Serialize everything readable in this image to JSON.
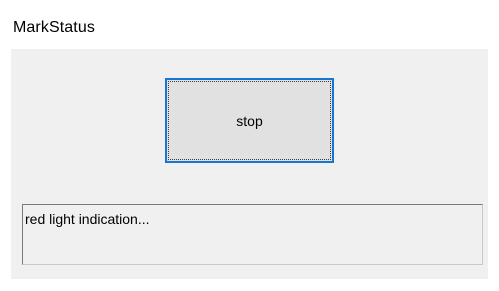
{
  "window": {
    "title": "MarkStatus"
  },
  "controls": {
    "stop_button_label": "stop",
    "status_text": "red light indication..."
  },
  "colors": {
    "panel_background": "#f0f0f0",
    "button_face": "#e1e1e1",
    "button_focus_border": "#1677d2"
  }
}
